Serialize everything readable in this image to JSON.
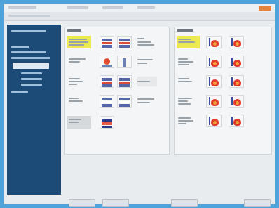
{
  "app": {
    "accent": "#e8833a",
    "sidebar_color": "#1d4b78",
    "highlight_color": "#ecea4e",
    "icon_color": "#e23b2a"
  },
  "window": {
    "title": "",
    "close_icon": "close-icon"
  },
  "sidebar": {
    "items": [
      "",
      "",
      "",
      "",
      "",
      "",
      "",
      "",
      ""
    ],
    "selected_index": 4
  },
  "left_panel": {
    "title": "",
    "rows": [
      {
        "label": "",
        "highlighted": true,
        "thumbs": [
          "stack",
          "stack"
        ],
        "icon": "layer-stack-icon"
      },
      {
        "label": "",
        "highlighted": false,
        "thumbs": [
          "blob",
          "pin"
        ],
        "icon": "heat-source-icon"
      },
      {
        "label": "",
        "highlighted": false,
        "thumbs": [
          "stack",
          "stack"
        ],
        "icon": "layer-stack-icon"
      },
      {
        "label": "",
        "highlighted": false,
        "thumbs": [
          "stack",
          "stack"
        ],
        "icon": "layer-stack-icon"
      },
      {
        "label": "",
        "highlighted": false,
        "gray": true,
        "thumbs": [
          "stack"
        ],
        "icon": "layer-stack-icon"
      }
    ]
  },
  "right_panel": {
    "title": "",
    "rows": [
      {
        "label": "",
        "highlighted": true,
        "icons": [
          "heat-icon",
          "heat-icon"
        ]
      },
      {
        "label": "",
        "highlighted": false,
        "icons": [
          "heat-icon",
          "heat-icon"
        ]
      },
      {
        "label": "",
        "highlighted": false,
        "icons": [
          "heat-icon",
          "heat-icon"
        ]
      },
      {
        "label": "",
        "highlighted": false,
        "icons": [
          "heat-icon",
          "heat-icon"
        ]
      },
      {
        "label": "",
        "highlighted": false,
        "icons": [
          "heat-icon",
          "heat-icon"
        ]
      }
    ]
  },
  "footer": {
    "buttons": [
      "",
      "",
      "",
      ""
    ]
  }
}
